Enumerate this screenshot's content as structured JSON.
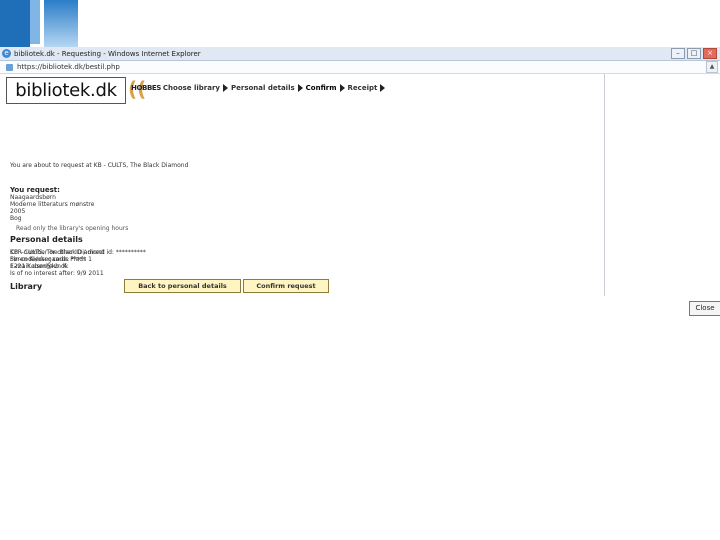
{
  "window": {
    "title": "bibliotek.dk - Requesting - Windows Internet Explorer",
    "url": "https://bibliotek.dk/bestil.php",
    "ie_icon": "e"
  },
  "header": {
    "logo_text": "bibliotek.dk",
    "logo_mark": "((",
    "steps": [
      "HOBBES",
      "Choose library",
      "Personal details",
      "Confirm",
      "Receipt"
    ]
  },
  "intro": "You are about to request at KB - CULTS, The Black Diamond",
  "request": {
    "heading": "You request:",
    "lines": [
      "Naagaardsbørn",
      "Moderne litteraturs mønstre",
      "2005",
      "Bog"
    ],
    "note": "Read only the library's opening hours"
  },
  "personal": {
    "heading": "Personal details",
    "lines": [
      "CPR-number or other ID / direct id: **********",
      "Pin-code/user code: *****",
      "E-mail: user@kb.dk",
      "Is of no interest after: 9/9 2011"
    ]
  },
  "library": {
    "heading": "Library",
    "lines": [
      "KB - CULTS, The Black Diamond",
      "Søren Kierkegaards Plads 1",
      "1221 København K"
    ]
  },
  "buttons": {
    "back": "Back to personal details",
    "confirm": "Confirm request",
    "close": "Close"
  }
}
